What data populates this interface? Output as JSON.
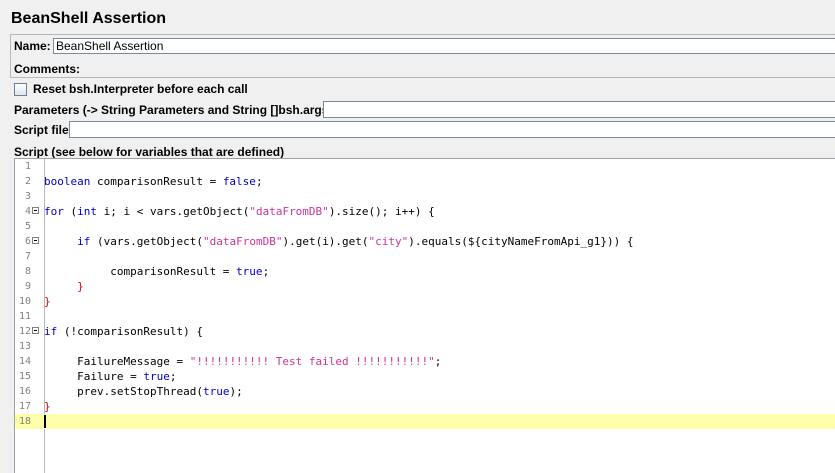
{
  "title": "BeanShell Assertion",
  "name_label": "Name:",
  "name_value": "BeanShell Assertion",
  "comments_label": "Comments:",
  "reset_label": "Reset bsh.Interpreter before each call",
  "params_label": "Parameters (-> String Parameters and String []bsh.args)",
  "script_file_label": "Script file",
  "script_label": "Script (see below for variables that are defined)",
  "editor": {
    "current_line": 18,
    "lines": [
      {
        "n": "1",
        "fold": false,
        "tokens": []
      },
      {
        "n": "2",
        "fold": false,
        "tokens": [
          {
            "t": "kw",
            "v": "boolean"
          },
          {
            "t": "",
            "v": " comparisonResult = "
          },
          {
            "t": "kw",
            "v": "false"
          },
          {
            "t": "",
            "v": ";"
          }
        ]
      },
      {
        "n": "3",
        "fold": false,
        "tokens": []
      },
      {
        "n": "4",
        "fold": true,
        "tokens": [
          {
            "t": "kw",
            "v": "for"
          },
          {
            "t": "",
            "v": " ("
          },
          {
            "t": "kw",
            "v": "int"
          },
          {
            "t": "",
            "v": " i; i < vars.getObject("
          },
          {
            "t": "str",
            "v": "\"dataFromDB\""
          },
          {
            "t": "",
            "v": ").size(); i++) {"
          }
        ]
      },
      {
        "n": "5",
        "fold": false,
        "tokens": []
      },
      {
        "n": "6",
        "fold": true,
        "tokens": [
          {
            "t": "",
            "v": "     "
          },
          {
            "t": "kw",
            "v": "if"
          },
          {
            "t": "",
            "v": " (vars.getObject("
          },
          {
            "t": "str",
            "v": "\"dataFromDB\""
          },
          {
            "t": "",
            "v": ").get(i).get("
          },
          {
            "t": "str",
            "v": "\"city\""
          },
          {
            "t": "",
            "v": ").equals(${cityNameFromApi_g1})) {"
          }
        ]
      },
      {
        "n": "7",
        "fold": false,
        "tokens": []
      },
      {
        "n": "8",
        "fold": false,
        "tokens": [
          {
            "t": "",
            "v": "          comparisonResult = "
          },
          {
            "t": "kw",
            "v": "true"
          },
          {
            "t": "",
            "v": ";"
          }
        ]
      },
      {
        "n": "9",
        "fold": false,
        "tokens": [
          {
            "t": "",
            "v": "     "
          },
          {
            "t": "pun",
            "v": "}"
          }
        ]
      },
      {
        "n": "10",
        "fold": false,
        "tokens": [
          {
            "t": "pun",
            "v": "}"
          }
        ]
      },
      {
        "n": "11",
        "fold": false,
        "tokens": []
      },
      {
        "n": "12",
        "fold": true,
        "tokens": [
          {
            "t": "kw",
            "v": "if"
          },
          {
            "t": "",
            "v": " (!comparisonResult) {"
          }
        ]
      },
      {
        "n": "13",
        "fold": false,
        "tokens": []
      },
      {
        "n": "14",
        "fold": false,
        "tokens": [
          {
            "t": "",
            "v": "     FailureMessage = "
          },
          {
            "t": "str",
            "v": "\"!!!!!!!!!!! Test failed !!!!!!!!!!!\""
          },
          {
            "t": "",
            "v": ";"
          }
        ]
      },
      {
        "n": "15",
        "fold": false,
        "tokens": [
          {
            "t": "",
            "v": "     Failure = "
          },
          {
            "t": "kw",
            "v": "true"
          },
          {
            "t": "",
            "v": ";"
          }
        ]
      },
      {
        "n": "16",
        "fold": false,
        "tokens": [
          {
            "t": "",
            "v": "     prev.setStopThread("
          },
          {
            "t": "kw",
            "v": "true"
          },
          {
            "t": "",
            "v": ");"
          }
        ]
      },
      {
        "n": "17",
        "fold": false,
        "tokens": [
          {
            "t": "pun",
            "v": "}"
          }
        ]
      },
      {
        "n": "18",
        "fold": false,
        "tokens": []
      }
    ]
  }
}
